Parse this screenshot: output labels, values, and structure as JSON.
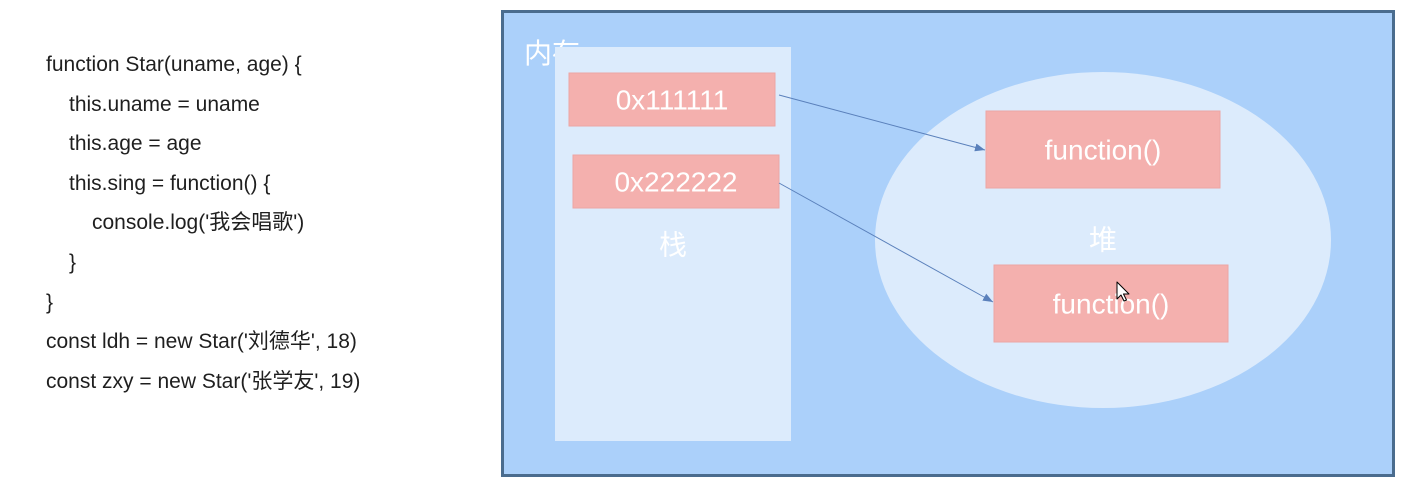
{
  "code": {
    "lines": [
      "function Star(uname, age) {",
      "this.uname = uname",
      "this.age = age",
      "this.sing = function() {",
      "console.log('我会唱歌')",
      "}",
      "}",
      "const ldh = new Star('刘德华', 18)",
      "const zxy = new Star('张学友', 19)"
    ]
  },
  "diagram": {
    "memory_label": "内存",
    "stack": {
      "label": "栈",
      "addresses": [
        "0x111111",
        "0x222222"
      ]
    },
    "heap": {
      "label": "堆",
      "objects": [
        "function()",
        "function()"
      ]
    },
    "pointers": [
      {
        "from": 0,
        "to": 0
      },
      {
        "from": 1,
        "to": 1
      }
    ]
  },
  "colors": {
    "memory_background": "#abd0fa",
    "memory_border": "#4a6c8e",
    "region_fill": "#dcebfc",
    "box_fill": "#f4b0ae",
    "box_border": "#eda6a4",
    "label_text": "#ffffff",
    "arrow": "#5a80bb",
    "code_text": "#1f1f1f"
  }
}
